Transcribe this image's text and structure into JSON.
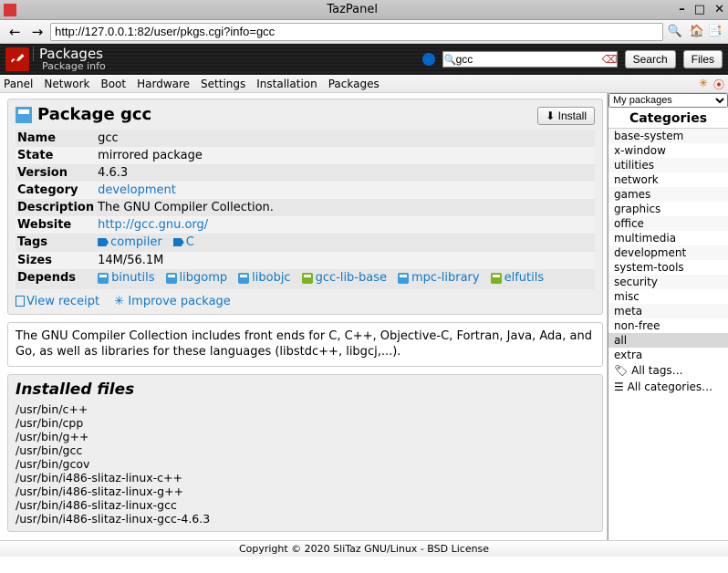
{
  "window": {
    "title": "TazPanel"
  },
  "nav": {
    "url": "http://127.0.0.1:82/user/pkgs.cgi?info=gcc"
  },
  "appbar": {
    "title": "Packages",
    "subtitle": "Package info",
    "search_value": "gcc",
    "search_btn": "Search",
    "files_btn": "Files"
  },
  "menu": {
    "items": [
      "Panel",
      "Network",
      "Boot",
      "Hardware",
      "Settings",
      "Installation",
      "Packages"
    ]
  },
  "package": {
    "heading": "Package gcc",
    "install_btn": "Install",
    "rows": {
      "name_k": "Name",
      "name_v": "gcc",
      "state_k": "State",
      "state_v": "mirrored package",
      "version_k": "Version",
      "version_v": "4.6.3",
      "category_k": "Category",
      "category_v": "development",
      "desc_k": "Description",
      "desc_v": "The GNU Compiler Collection.",
      "website_k": "Website",
      "website_v": "http://gcc.gnu.org/",
      "tags_k": "Tags",
      "sizes_k": "Sizes",
      "sizes_v": "14M/56.1M",
      "depends_k": "Depends"
    },
    "tags": [
      "compiler",
      "C"
    ],
    "depends": [
      {
        "name": "binutils",
        "g": false
      },
      {
        "name": "libgomp",
        "g": false
      },
      {
        "name": "libobjc",
        "g": false
      },
      {
        "name": "gcc-lib-base",
        "g": true
      },
      {
        "name": "mpc-library",
        "g": false
      },
      {
        "name": "elfutils",
        "g": true
      }
    ],
    "view_receipt": "View receipt",
    "improve": "Improve package"
  },
  "description": "The GNU Compiler Collection includes front ends for C, C++, Objective-C, Fortran, Java, Ada, and Go, as well as libraries for these languages (libstdc++, libgcj,...).",
  "installed_files": {
    "heading": "Installed files",
    "list": [
      "/usr/bin/c++",
      "/usr/bin/cpp",
      "/usr/bin/g++",
      "/usr/bin/gcc",
      "/usr/bin/gcov",
      "/usr/bin/i486-slitaz-linux-c++",
      "/usr/bin/i486-slitaz-linux-g++",
      "/usr/bin/i486-slitaz-linux-gcc",
      "/usr/bin/i486-slitaz-linux-gcc-4.6.3"
    ]
  },
  "sidebar": {
    "selector": "My packages",
    "heading": "Categories",
    "cats": [
      "base-system",
      "x-window",
      "utilities",
      "network",
      "games",
      "graphics",
      "office",
      "multimedia",
      "development",
      "system-tools",
      "security",
      "misc",
      "meta",
      "non-free",
      "all",
      "extra"
    ],
    "selected": "all",
    "all_tags": "All tags…",
    "all_cats": "All categories…"
  },
  "footer": "Copyright © 2020 SliTaz GNU/Linux - BSD License"
}
